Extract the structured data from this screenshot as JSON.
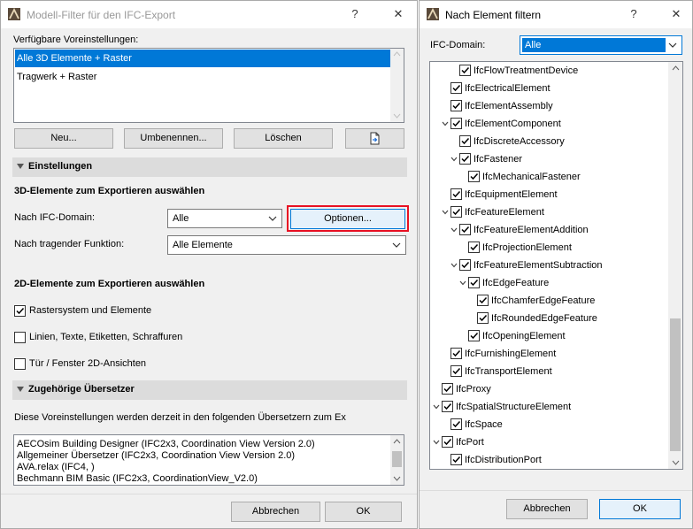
{
  "left_dialog": {
    "title": "Modell-Filter für den IFC-Export",
    "help_glyph": "?",
    "close_glyph": "✕",
    "presets_label": "Verfügbare Voreinstellungen:",
    "presets": [
      {
        "label": "Alle 3D Elemente + Raster",
        "selected": true
      },
      {
        "label": "Tragwerk + Raster",
        "selected": false
      }
    ],
    "buttons": {
      "new": "Neu...",
      "rename": "Umbenennen...",
      "delete": "Löschen"
    },
    "settings": {
      "header": "Einstellungen",
      "subheader_3d": "3D-Elemente zum Exportieren auswählen",
      "ifc_domain_label": "Nach IFC-Domain:",
      "ifc_domain_value": "Alle",
      "options_button": "Optionen...",
      "function_label": "Nach tragender Funktion:",
      "function_value": "Alle Elemente",
      "subheader_2d": "2D-Elemente zum Exportieren auswählen",
      "checkboxes": [
        {
          "label": "Rastersystem und Elemente",
          "checked": true
        },
        {
          "label": "Linien, Texte, Etiketten, Schraffuren",
          "checked": false
        },
        {
          "label": "Tür / Fenster 2D-Ansichten",
          "checked": false
        }
      ]
    },
    "translators": {
      "header": "Zugehörige Übersetzer",
      "description": "Diese Voreinstellungen werden derzeit in den folgenden Übersetzern zum Ex",
      "items": [
        "AECOsim Building Designer (IFC2x3, Coordination View Version 2.0)",
        "Allgemeiner Übersetzer (IFC2x3, Coordination View Version 2.0)",
        "AVA.relax (IFC4, )",
        "Bechmann BIM Basic (IFC2x3, CoordinationView_V2.0)"
      ]
    },
    "cancel": "Abbrechen",
    "ok": "OK"
  },
  "right_dialog": {
    "title": "Nach Element filtern",
    "help_glyph": "?",
    "close_glyph": "✕",
    "domain_label": "IFC-Domain:",
    "domain_value": "Alle",
    "tree": [
      {
        "label": "IfcFlowTreatmentDevice",
        "level": 2,
        "expandable": false,
        "checked": true
      },
      {
        "label": "IfcElectricalElement",
        "level": 1,
        "expandable": false,
        "checked": true
      },
      {
        "label": "IfcElementAssembly",
        "level": 1,
        "expandable": false,
        "checked": true
      },
      {
        "label": "IfcElementComponent",
        "level": 1,
        "expandable": true,
        "checked": true
      },
      {
        "label": "IfcDiscreteAccessory",
        "level": 2,
        "expandable": false,
        "checked": true
      },
      {
        "label": "IfcFastener",
        "level": 2,
        "expandable": true,
        "checked": true
      },
      {
        "label": "IfcMechanicalFastener",
        "level": 3,
        "expandable": false,
        "checked": true
      },
      {
        "label": "IfcEquipmentElement",
        "level": 1,
        "expandable": false,
        "checked": true
      },
      {
        "label": "IfcFeatureElement",
        "level": 1,
        "expandable": true,
        "checked": true
      },
      {
        "label": "IfcFeatureElementAddition",
        "level": 2,
        "expandable": true,
        "checked": true
      },
      {
        "label": "IfcProjectionElement",
        "level": 3,
        "expandable": false,
        "checked": true
      },
      {
        "label": "IfcFeatureElementSubtraction",
        "level": 2,
        "expandable": true,
        "checked": true
      },
      {
        "label": "IfcEdgeFeature",
        "level": 3,
        "expandable": true,
        "checked": true
      },
      {
        "label": "IfcChamferEdgeFeature",
        "level": 4,
        "expandable": false,
        "checked": true
      },
      {
        "label": "IfcRoundedEdgeFeature",
        "level": 4,
        "expandable": false,
        "checked": true
      },
      {
        "label": "IfcOpeningElement",
        "level": 3,
        "expandable": false,
        "checked": true
      },
      {
        "label": "IfcFurnishingElement",
        "level": 1,
        "expandable": false,
        "checked": true
      },
      {
        "label": "IfcTransportElement",
        "level": 1,
        "expandable": false,
        "checked": true
      },
      {
        "label": "IfcProxy",
        "level": 0,
        "expandable": false,
        "checked": true
      },
      {
        "label": "IfcSpatialStructureElement",
        "level": 0,
        "expandable": true,
        "checked": true
      },
      {
        "label": "IfcSpace",
        "level": 1,
        "expandable": false,
        "checked": true
      },
      {
        "label": "IfcPort",
        "level": 0,
        "expandable": true,
        "checked": true
      },
      {
        "label": "IfcDistributionPort",
        "level": 1,
        "expandable": false,
        "checked": true
      }
    ],
    "cancel": "Abbrechen",
    "ok": "OK"
  },
  "colors": {
    "selection": "#0078d7",
    "highlight_border": "#e81123",
    "dialog_bg": "#f0f0f0",
    "section_bg": "#dcdcdc"
  }
}
